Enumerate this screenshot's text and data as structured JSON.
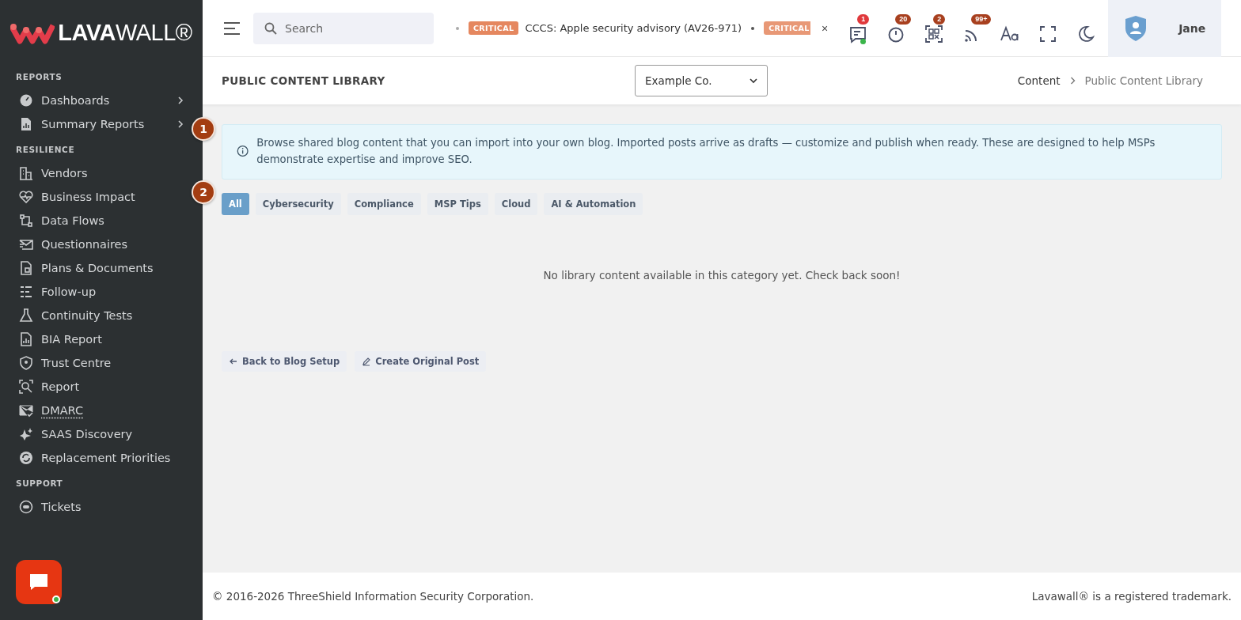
{
  "sidebar": {
    "logo": "**LAVA**WALL®",
    "sections": [
      {
        "title": "REPORTS",
        "items": [
          {
            "label": "Dashboards",
            "expandable": true,
            "underlined": false
          },
          {
            "label": "Summary Reports",
            "expandable": true,
            "underlined": false
          }
        ]
      },
      {
        "title": "RESILIENCE",
        "items": [
          {
            "label": "Vendors",
            "expandable": false,
            "underlined": false
          },
          {
            "label": "Business Impact",
            "expandable": false,
            "underlined": false
          },
          {
            "label": "Data Flows",
            "expandable": false,
            "underlined": false
          },
          {
            "label": "Questionnaires",
            "expandable": false,
            "underlined": false
          },
          {
            "label": "Plans & Documents",
            "expandable": false,
            "underlined": false
          },
          {
            "label": "Follow-up",
            "expandable": false,
            "underlined": false
          },
          {
            "label": "Continuity Tests",
            "expandable": false,
            "underlined": false
          },
          {
            "label": "BIA Report",
            "expandable": false,
            "underlined": false
          },
          {
            "label": "Trust Centre",
            "expandable": false,
            "underlined": false
          },
          {
            "label": "Report",
            "expandable": false,
            "underlined": false
          },
          {
            "label": "DMARC",
            "expandable": false,
            "underlined": true
          },
          {
            "label": "SAAS Discovery",
            "expandable": false,
            "underlined": false
          },
          {
            "label": "Replacement Priorities",
            "expandable": false,
            "underlined": false
          }
        ]
      },
      {
        "title": "SUPPORT",
        "items": [
          {
            "label": "Tickets",
            "expandable": false,
            "underlined": false
          }
        ]
      }
    ],
    "chat_launcher": {
      "online": true
    }
  },
  "topbar": {
    "search": {
      "placeholder": "Search"
    },
    "ticker": [
      {
        "severity": "CRITICAL",
        "text": "CCCS: Apple security advisory (AV26-971)"
      },
      {
        "severity": "CRITICAL"
      }
    ],
    "ticker_close": "×",
    "notifications": [
      {
        "count": "1",
        "color": "#e0393c",
        "online": true
      },
      {
        "count": "20",
        "color": "#a8401f",
        "online": false
      },
      {
        "count": "2",
        "color": "#a8401f",
        "online": false
      },
      {
        "count": "99+",
        "color": "#a8401f",
        "online": false
      }
    ],
    "user": {
      "name": "Jane"
    }
  },
  "page_header": {
    "title": "PUBLIC CONTENT LIBRARY",
    "company_select": {
      "value": "Example Co."
    },
    "breadcrumb": [
      "Content",
      "Public Content Library"
    ]
  },
  "info": {
    "text": "Browse shared blog content that you can import into your own blog. Imported posts arrive as drafts — customize and publish when ready. These are designed to help MSPs demonstrate expertise and improve SEO."
  },
  "filters": [
    {
      "label": "All",
      "selected": true
    },
    {
      "label": "Cybersecurity",
      "selected": false
    },
    {
      "label": "Compliance",
      "selected": false
    },
    {
      "label": "MSP Tips",
      "selected": false
    },
    {
      "label": "Cloud",
      "selected": false
    },
    {
      "label": "AI & Automation",
      "selected": false
    }
  ],
  "empty_message": "No library content available in this category yet. Check back soon!",
  "actions": [
    {
      "label": "Back to Blog Setup"
    },
    {
      "label": "Create Original Post"
    }
  ],
  "callouts": [
    "1",
    "2"
  ],
  "footer": {
    "copyright": "© 2016-2026 ThreeShield Information Security Corporation.",
    "trademark": "Lavawall® is a registered trademark."
  }
}
